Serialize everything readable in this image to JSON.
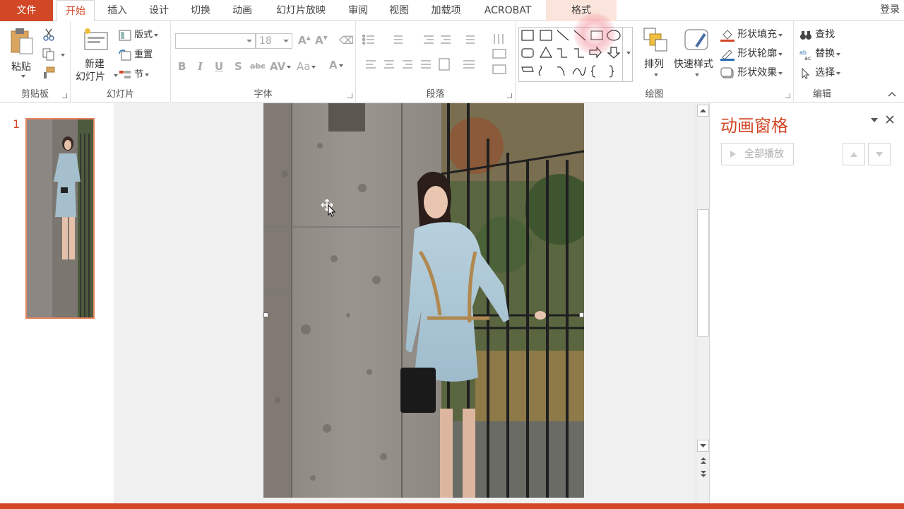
{
  "tabs": {
    "file": "文件",
    "home": "开始",
    "insert": "插入",
    "design": "设计",
    "transitions": "切换",
    "animations": "动画",
    "slideshow": "幻灯片放映",
    "review": "审阅",
    "view": "视图",
    "addins": "加载项",
    "acrobat": "ACROBAT",
    "format": "格式"
  },
  "login": "登录",
  "clipboard": {
    "paste": "粘贴",
    "label": "剪贴板"
  },
  "slides": {
    "new_line1": "新建",
    "new_line2": "幻灯片",
    "layout": "版式",
    "reset": "重置",
    "section": "节",
    "label": "幻灯片"
  },
  "font": {
    "size": "18",
    "label": "字体"
  },
  "paragraph": {
    "label": "段落"
  },
  "drawing": {
    "arrange": "排列",
    "quick_styles": "快速样式",
    "shape_fill": "形状填充",
    "shape_outline": "形状轮廓",
    "shape_effects": "形状效果",
    "label": "绘图"
  },
  "editing": {
    "find": "查找",
    "replace": "替换",
    "select": "选择",
    "label": "编辑"
  },
  "thumbnail": {
    "number": "1"
  },
  "animation_pane": {
    "title": "动画窗格",
    "play_all": "全部播放"
  },
  "colors": {
    "accent": "#d24726"
  }
}
